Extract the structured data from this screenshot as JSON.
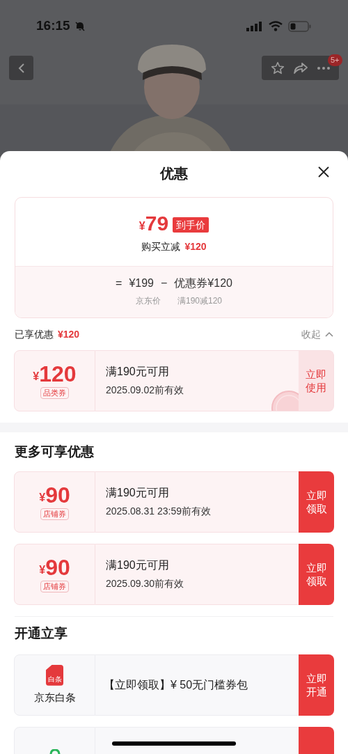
{
  "status_bar": {
    "time": "16:15",
    "muted": true
  },
  "top_bar": {
    "badge": "5+"
  },
  "sheet": {
    "title": "优惠"
  },
  "summary": {
    "currency": "¥",
    "final_price": "79",
    "final_tag": "到手价",
    "instant_label": "购买立减",
    "instant_amount": "¥120",
    "equals": "=",
    "base_price": "¥199",
    "minus": "−",
    "coupon_text": "优惠券¥120",
    "base_caption": "京东价",
    "coupon_caption": "满190减120"
  },
  "enjoyed": {
    "label": "已享优惠",
    "amount": "¥120",
    "toggle": "收起",
    "expanded": true
  },
  "enjoyed_coupons": [
    {
      "currency": "¥",
      "amount": "120",
      "type": "品类券",
      "condition": "满190元可用",
      "validity": "2025.09.02前有效",
      "action": "立即使用",
      "claimed": true
    }
  ],
  "more": {
    "title": "更多可享优惠"
  },
  "more_coupons": [
    {
      "currency": "¥",
      "amount": "90",
      "type": "店铺券",
      "condition": "满190元可用",
      "validity": "2025.08.31 23:59前有效",
      "action": "立即领取",
      "claimed": false
    },
    {
      "currency": "¥",
      "amount": "90",
      "type": "店铺券",
      "condition": "满190元可用",
      "validity": "2025.09.30前有效",
      "action": "立即领取",
      "claimed": false
    }
  ],
  "activate": {
    "title": "开通立享"
  },
  "activate_items": [
    {
      "kind": "baitiao",
      "icon_label": "白条",
      "name": "京东白条",
      "offer": "【立即领取】¥ 50无门槛券包",
      "action": "立即开通"
    },
    {
      "kind": "bag"
    }
  ]
}
